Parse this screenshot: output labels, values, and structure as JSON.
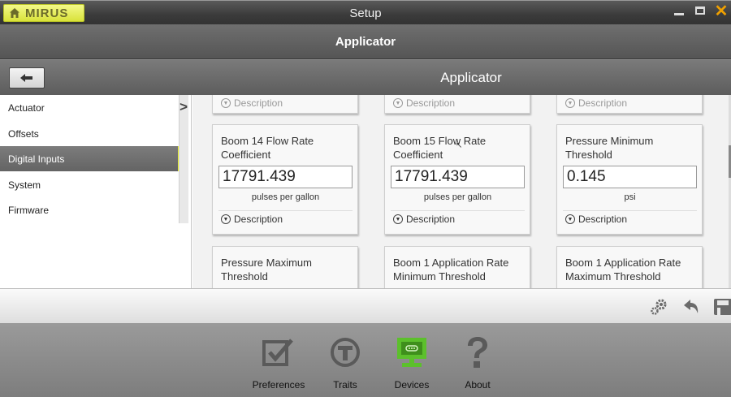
{
  "window": {
    "brand": "MIRUS",
    "title": "Setup"
  },
  "header": {
    "title": "Applicator"
  },
  "nav": {
    "title": "Applicator"
  },
  "sidebar": {
    "items": [
      {
        "label": "Actuator"
      },
      {
        "label": "Offsets"
      },
      {
        "label": "Digital Inputs",
        "active": true
      },
      {
        "label": "System"
      },
      {
        "label": "Firmware"
      }
    ]
  },
  "content": {
    "description_label": "Description",
    "cards": [
      {
        "title": "Boom 14 Flow Rate Coefficient",
        "value": "17791.439",
        "unit": "pulses per gallon"
      },
      {
        "title": "Boom 15 Flow Rate Coefficient",
        "value": "17791.439",
        "unit": "pulses per gallon"
      },
      {
        "title": "Pressure Minimum Threshold",
        "value": "0.145",
        "unit": "psi"
      },
      {
        "title": "Pressure Maximum Threshold"
      },
      {
        "title": "Boom 1 Application Rate Minimum Threshold"
      },
      {
        "title": "Boom 1 Application Rate Maximum Threshold"
      }
    ]
  },
  "toolbar": {
    "icons": [
      "gears-icon",
      "undo-icon",
      "save-icon"
    ]
  },
  "dock": {
    "items": [
      {
        "label": "Preferences",
        "icon": "checkbox-icon"
      },
      {
        "label": "Traits",
        "icon": "traits-icon"
      },
      {
        "label": "Devices",
        "icon": "monitor-icon",
        "active": true
      },
      {
        "label": "About",
        "icon": "question-icon"
      }
    ]
  },
  "colors": {
    "accent": "#e6ee2f",
    "devices_green": "#5cc02c",
    "dock_icon": "#5a5a5a"
  }
}
